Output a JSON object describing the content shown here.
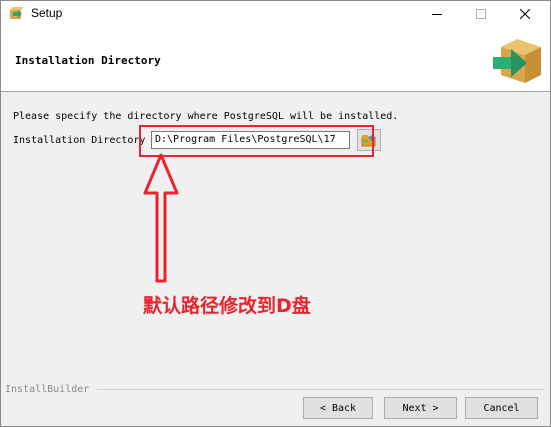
{
  "window": {
    "title": "Setup"
  },
  "header": {
    "title": "Installation Directory"
  },
  "main": {
    "description": "Please specify the directory where PostgreSQL will be installed.",
    "directory_label": "Installation Directory",
    "directory_value": "D:\\Program Files\\PostgreSQL\\17"
  },
  "annotation": {
    "text": "默认路径修改到D盘",
    "color": "#e8242c"
  },
  "footer": {
    "brand": "InstallBuilder",
    "back_label": "< Back",
    "next_label": "Next >",
    "cancel_label": "Cancel"
  },
  "icons": [
    "app-icon",
    "minimize-icon",
    "maximize-icon",
    "close-icon",
    "installer-box-icon",
    "folder-browse-icon"
  ]
}
